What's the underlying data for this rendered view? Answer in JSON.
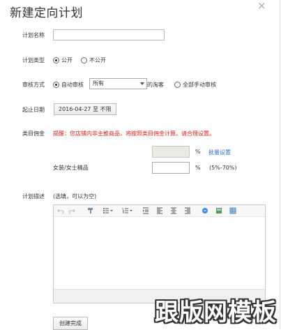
{
  "dialog": {
    "title": "新建定向计划",
    "close_glyph": "×"
  },
  "form": {
    "plan_name": {
      "label": "计划名称",
      "value": "",
      "placeholder": ""
    },
    "plan_type": {
      "label": "计划类型",
      "options": [
        "公开",
        "不公开"
      ],
      "selected": "公开"
    },
    "review": {
      "label": "审核方式",
      "auto_label": "自动审核",
      "select_value": "所有",
      "suffix": "的淘客",
      "manual_label": "全部手动审核",
      "selected": "自动审核"
    },
    "dates": {
      "label": "起止日期",
      "range": "2016-04-27 至 不限"
    },
    "category_commission": {
      "label": "类目佣金",
      "warning": "提醒：您店铺内非主推商品，将按照类目佣金计算。请合理设置。",
      "row1": {
        "value": "",
        "unit": "%",
        "link": "批量设置"
      },
      "row2": {
        "category": "女装/女士精品",
        "value": "",
        "unit": "%",
        "hint": "(5%-70%)"
      }
    },
    "description": {
      "label": "计划描述",
      "hint": "(选填，可以为空)"
    },
    "submit_label": "创建完成"
  },
  "editor_toolbar": [
    "undo-icon",
    "redo-icon",
    "format-brush-icon",
    "unordered-list-icon",
    "ordered-list-icon",
    "indent-icon",
    "align-left-icon",
    "align-center-icon",
    "align-right-icon",
    "link-icon",
    "image-icon",
    "table-icon"
  ],
  "watermark": "跟版网模板",
  "colors": {
    "warning": "#e41d1d",
    "link": "#2a6fc9"
  }
}
